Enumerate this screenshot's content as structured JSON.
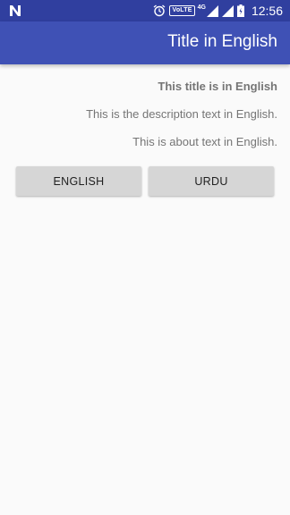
{
  "status_bar": {
    "volte_label": "VoLTE",
    "network_label": "4G",
    "time": "12:56",
    "icons": [
      "n-logo-icon",
      "alarm-icon",
      "signal-icon",
      "battery-icon"
    ]
  },
  "app_bar": {
    "title": "Title in English"
  },
  "content": {
    "heading": "This title is in English",
    "description": "This is the description text in English.",
    "about": "This is about text in English."
  },
  "buttons": {
    "english_label": "ENGLISH",
    "urdu_label": "URDU"
  },
  "colors": {
    "status_bar": "#303f9f",
    "app_bar": "#3f51b5",
    "background": "#fafafa",
    "button": "#d6d6d6"
  }
}
